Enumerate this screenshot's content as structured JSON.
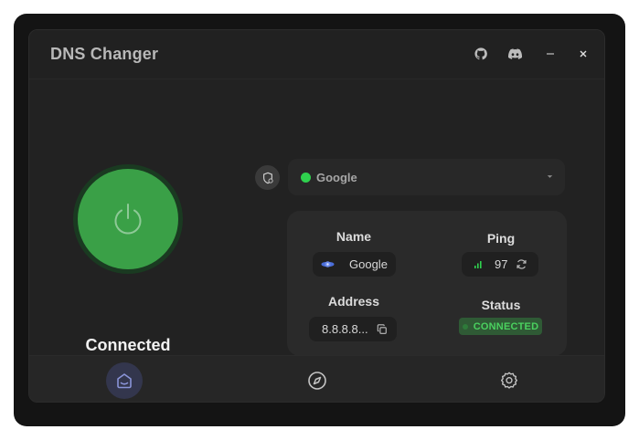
{
  "app": {
    "title": "DNS Changer"
  },
  "titlebar": {
    "icons": [
      "github-icon",
      "discord-icon",
      "minimize-icon",
      "close-icon"
    ]
  },
  "power": {
    "state_label": "Connected",
    "color": "#3aa047"
  },
  "server_select": {
    "selected": "Google",
    "status_color": "#2fd14e"
  },
  "info": {
    "name_label": "Name",
    "name_value": "Google",
    "ping_label": "Ping",
    "ping_value": "97",
    "address_label": "Address",
    "address_value": "8.8.8.8...",
    "status_label": "Status",
    "status_value": "CONNECTED"
  },
  "nav": {
    "items": [
      "home-icon",
      "explore-icon",
      "settings-icon"
    ],
    "active": "home-icon"
  }
}
